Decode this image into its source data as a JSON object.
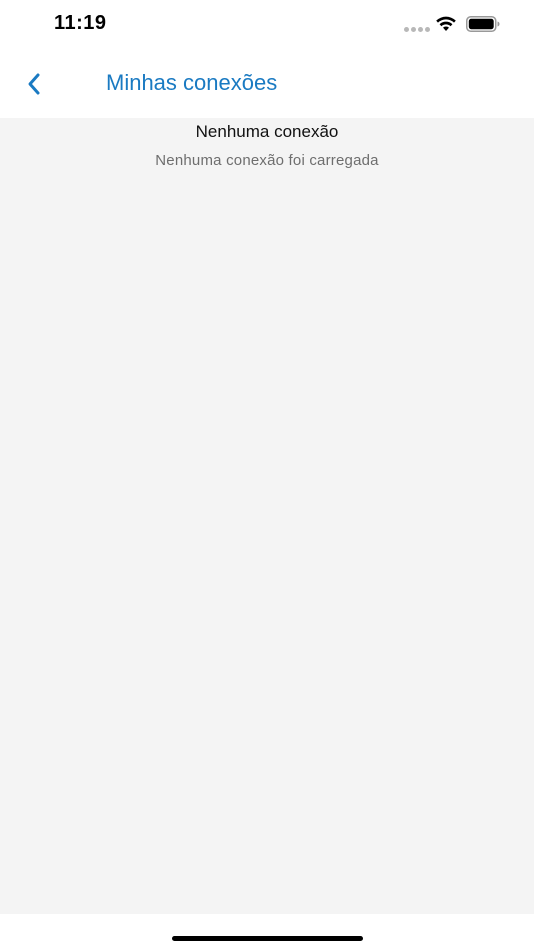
{
  "status_bar": {
    "time": "11:19",
    "signal_icon": "cellular-dots-icon",
    "wifi_icon": "wifi-icon",
    "battery_icon": "battery-full-icon"
  },
  "nav_bar": {
    "back_icon": "chevron-left-icon",
    "title": "Minhas conexões"
  },
  "empty_state": {
    "title": "Nenhuma conexão",
    "message": "Nenhuma conexão foi carregada"
  },
  "colors": {
    "accent": "#1a7ac2",
    "background": "#f4f4f4",
    "subtitle": "#6e6e6e"
  }
}
